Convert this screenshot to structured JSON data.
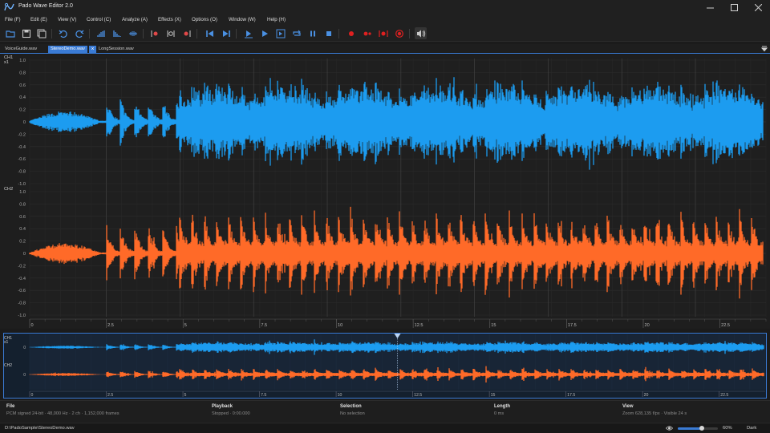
{
  "window": {
    "title": "Pado Wave Editor 2.0",
    "minimize_icon": "minimize-icon",
    "maximize_icon": "maximize-icon",
    "close_icon": "close-icon"
  },
  "menu": [
    {
      "label": "File (F)"
    },
    {
      "label": "Edit (E)"
    },
    {
      "label": "View (V)"
    },
    {
      "label": "Control (C)"
    },
    {
      "label": "Analyze (A)"
    },
    {
      "label": "Effects (X)"
    },
    {
      "label": "Options (O)"
    },
    {
      "label": "Window (W)"
    },
    {
      "label": "Help (H)"
    }
  ],
  "toolbar": [
    {
      "icon": "open-folder-icon",
      "color": "#4a90e2"
    },
    {
      "icon": "save-icon",
      "color": "#c8c8c8"
    },
    {
      "icon": "save-all-icon",
      "color": "#c8c8c8"
    },
    {
      "icon": "undo-icon",
      "color": "#4a90e2"
    },
    {
      "icon": "redo-icon",
      "color": "#4a90e2"
    },
    {
      "icon": "amplitude-bars-icon",
      "color": "#4a90e2"
    },
    {
      "icon": "spectrum-icon",
      "color": "#4a90e2"
    },
    {
      "icon": "waveform-icon",
      "color": "#4a90e2"
    },
    {
      "icon": "marker-in-icon",
      "color": "#e04848"
    },
    {
      "icon": "marker-mid-icon",
      "color": "#c8c8c8"
    },
    {
      "icon": "marker-out-icon",
      "color": "#e04848"
    },
    {
      "icon": "skip-start-icon",
      "color": "#4a90e2"
    },
    {
      "icon": "skip-end-icon",
      "color": "#4a90e2"
    },
    {
      "icon": "play-selection-icon",
      "color": "#4a90e2"
    },
    {
      "icon": "play-icon",
      "color": "#4a90e2"
    },
    {
      "icon": "play-to-end-icon",
      "color": "#4a90e2"
    },
    {
      "icon": "loop-icon",
      "color": "#4a90e2"
    },
    {
      "icon": "pause-icon",
      "color": "#4a90e2"
    },
    {
      "icon": "stop-icon",
      "color": "#4a90e2"
    },
    {
      "icon": "record-icon",
      "color": "#e02020"
    },
    {
      "icon": "record-append-icon",
      "color": "#e02020"
    },
    {
      "icon": "record-selection-icon",
      "color": "#e02020"
    },
    {
      "icon": "record-stop-icon",
      "color": "#e02020"
    },
    {
      "icon": "speaker-settings-icon",
      "color": "#c8c8c8"
    }
  ],
  "tabs": [
    {
      "label": "VoiceGuide.wav",
      "active": false
    },
    {
      "label": "StereoDemo.wav",
      "active": true
    },
    {
      "label": "LongSession.wav",
      "active": false
    }
  ],
  "waveform": {
    "channels": [
      {
        "label": "CH1",
        "zoom": "x1",
        "color": "#1c9cf0"
      },
      {
        "label": "CH2",
        "zoom": "",
        "color": "#ff6a28"
      }
    ],
    "y_ticks": [
      "1.0",
      "0.8",
      "0.6",
      "0.4",
      "0.2",
      "0",
      "-0.2",
      "-0.4",
      "-0.6",
      "-0.8",
      "-1.0"
    ],
    "x_ticks": [
      0,
      2.5,
      5,
      7.5,
      10,
      12.5,
      15,
      17.5,
      20,
      22.5
    ],
    "x_tick_labels": [
      "0",
      "2.5",
      "5",
      "7.5",
      "10",
      "12.5",
      "15",
      "17.5",
      "20",
      "22.5"
    ],
    "x_range": [
      0,
      24
    ],
    "segment_boundaries": [
      2.5,
      4.9,
      7.3,
      9.7,
      12.1,
      14.5,
      16.9,
      19.3,
      21.7
    ],
    "grid": true
  },
  "overview": {
    "channels": [
      {
        "label": "CH1",
        "zoom": "x1",
        "zero_label": "0",
        "color": "#1c9cf0"
      },
      {
        "label": "CH2",
        "zoom": "",
        "zero_label": "0",
        "color": "#ff6a28"
      }
    ],
    "playhead_time": 12.0,
    "highlight_color": "#3a7bd5"
  },
  "info": {
    "file": {
      "title": "File",
      "value": "PCM signed 24-bit · 48,000 Hz · 2 ch · 1,152,000 frames"
    },
    "playback": {
      "title": "Playback",
      "value": "Stopped · 0:00.000"
    },
    "selection": {
      "title": "Selection",
      "value": "No selection"
    },
    "length": {
      "title": "Length",
      "value": "0 ms"
    },
    "view": {
      "title": "View",
      "value": "Zoom 628,135 f/px · Visible 24 s"
    }
  },
  "status": {
    "path": "D:\\PadoSample\\StereoDemo.wav",
    "zoom_percent": 60,
    "zoom_label": "60%",
    "theme": "Dark",
    "zoom_icon": "eye-icon"
  }
}
